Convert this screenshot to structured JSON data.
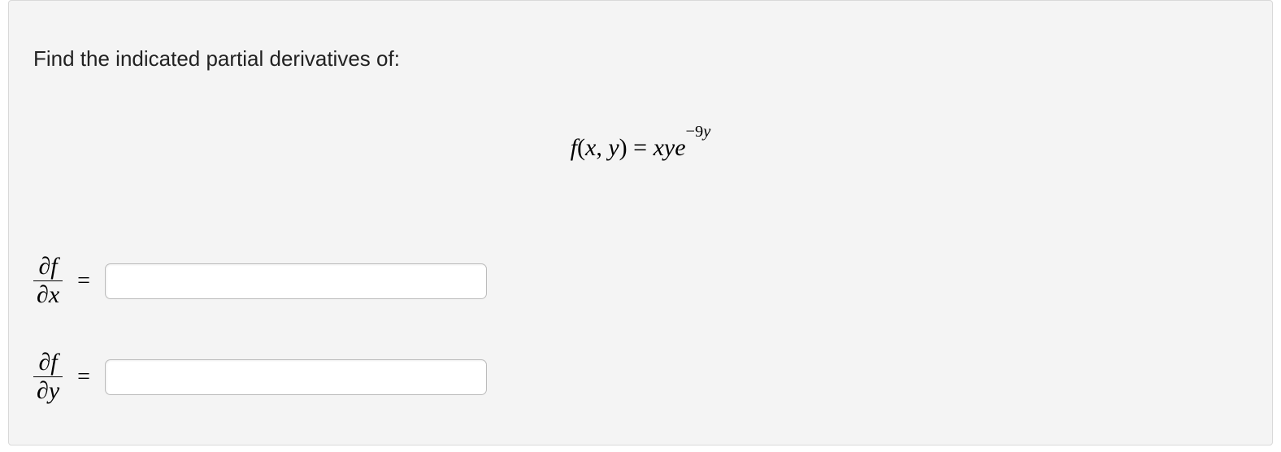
{
  "prompt": "Find the indicated partial derivatives of:",
  "equation": {
    "lhs_func": "f",
    "lhs_args_open": "(",
    "lhs_arg1": "x",
    "lhs_comma": ", ",
    "lhs_arg2": "y",
    "lhs_args_close": ")",
    "eq": " = ",
    "rhs_base": "xye",
    "rhs_exp_minus": "−",
    "rhs_exp_num": "9",
    "rhs_exp_var": "y"
  },
  "rows": [
    {
      "numerator": "∂f",
      "denominator": "∂x",
      "eq": "=",
      "value": ""
    },
    {
      "numerator": "∂f",
      "denominator": "∂y",
      "eq": "=",
      "value": ""
    }
  ]
}
